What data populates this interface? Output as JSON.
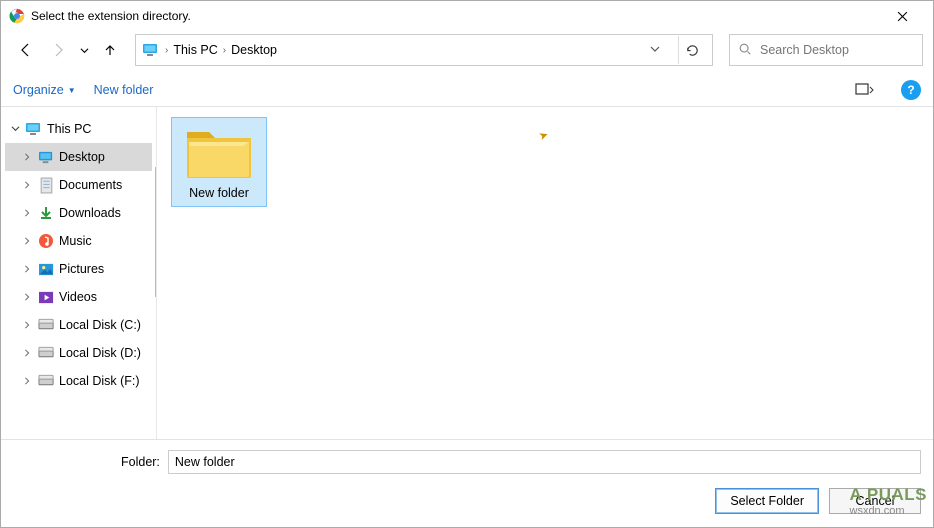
{
  "window": {
    "title": "Select the extension directory."
  },
  "breadcrumb": {
    "root": "This PC",
    "segments": [
      "Desktop"
    ]
  },
  "search": {
    "placeholder": "Search Desktop"
  },
  "cmdbar": {
    "organize": "Organize",
    "newfolder": "New folder"
  },
  "tree": {
    "root": {
      "label": "This PC",
      "icon": "monitor"
    },
    "items": [
      {
        "label": "Desktop",
        "icon": "desktop",
        "selected": true
      },
      {
        "label": "Documents",
        "icon": "documents",
        "selected": false
      },
      {
        "label": "Downloads",
        "icon": "downloads",
        "selected": false
      },
      {
        "label": "Music",
        "icon": "music",
        "selected": false
      },
      {
        "label": "Pictures",
        "icon": "pictures",
        "selected": false
      },
      {
        "label": "Videos",
        "icon": "videos",
        "selected": false
      },
      {
        "label": "Local Disk (C:)",
        "icon": "disk",
        "selected": false
      },
      {
        "label": "Local Disk (D:)",
        "icon": "disk",
        "selected": false
      },
      {
        "label": "Local Disk (F:)",
        "icon": "disk",
        "selected": false
      }
    ]
  },
  "content": {
    "items": [
      {
        "label": "New folder",
        "type": "folder",
        "selected": true
      }
    ]
  },
  "footer": {
    "folder_label": "Folder:",
    "folder_value": "New folder",
    "select_btn": "Select Folder",
    "cancel_btn": "Cancel"
  },
  "watermark": {
    "brand": "A   PUALS",
    "site": "wsxdn.com"
  }
}
